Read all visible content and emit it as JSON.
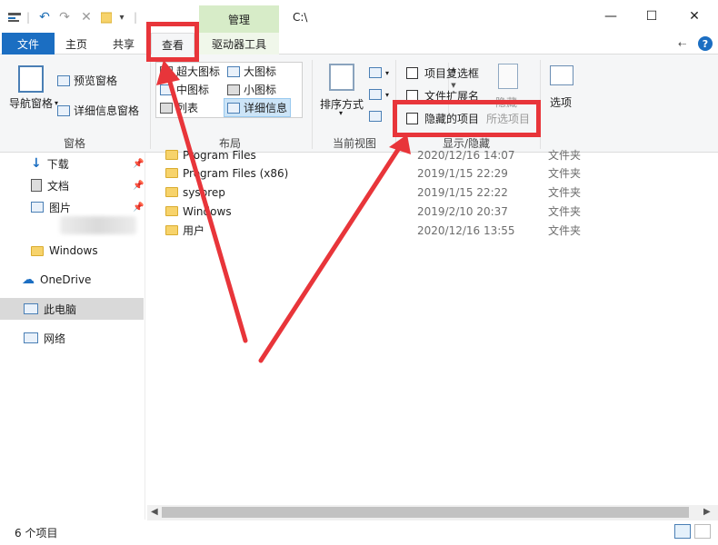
{
  "titlebar": {
    "manage_tab": "管理",
    "path": "C:\\",
    "minimize": "—",
    "maximize": "☐",
    "close": "✕"
  },
  "tabs": {
    "file": "文件",
    "home": "主页",
    "share": "共享",
    "view": "查看",
    "drive_tools": "驱动器工具"
  },
  "ribbon": {
    "panes": {
      "navigation_pane": "导航窗格",
      "preview_pane": "预览窗格",
      "details_pane": "详细信息窗格",
      "group": "窗格"
    },
    "layout": {
      "extra_large_icons": "超大图标",
      "large_icons": "大图标",
      "medium_icons": "中图标",
      "small_icons": "小图标",
      "list": "列表",
      "details": "详细信息",
      "group": "布局"
    },
    "current_view": {
      "sort_by": "排序方式",
      "group": "当前视图"
    },
    "show_hide": {
      "item_check_boxes": "项目复选框",
      "file_name_extensions": "文件扩展名",
      "hidden_items": "隐藏的项目",
      "hide_selected": "隐藏",
      "selected_items": "所选项目",
      "group": "显示/隐藏"
    },
    "options": "选项"
  },
  "sidebar": {
    "items": [
      {
        "label": "下载"
      },
      {
        "label": "文档"
      },
      {
        "label": "图片"
      },
      {
        "label": "Windows"
      },
      {
        "label": "OneDrive"
      },
      {
        "label": "此电脑"
      },
      {
        "label": "网络"
      }
    ]
  },
  "files": [
    {
      "name": "Program Files",
      "date": "2020/12/16 14:07",
      "type": "文件夹"
    },
    {
      "name": "Program Files (x86)",
      "date": "2019/1/15 22:29",
      "type": "文件夹"
    },
    {
      "name": "sysprep",
      "date": "2019/1/15 22:22",
      "type": "文件夹"
    },
    {
      "name": "Windows",
      "date": "2019/2/10 20:37",
      "type": "文件夹"
    },
    {
      "name": "用户",
      "date": "2020/12/16 13:55",
      "type": "文件夹"
    }
  ],
  "status": {
    "item_count": "6 个项目"
  },
  "colors": {
    "accent": "#1b6ec2",
    "annotation": "#e8353a",
    "manage_tab": "#d7ecc8"
  }
}
